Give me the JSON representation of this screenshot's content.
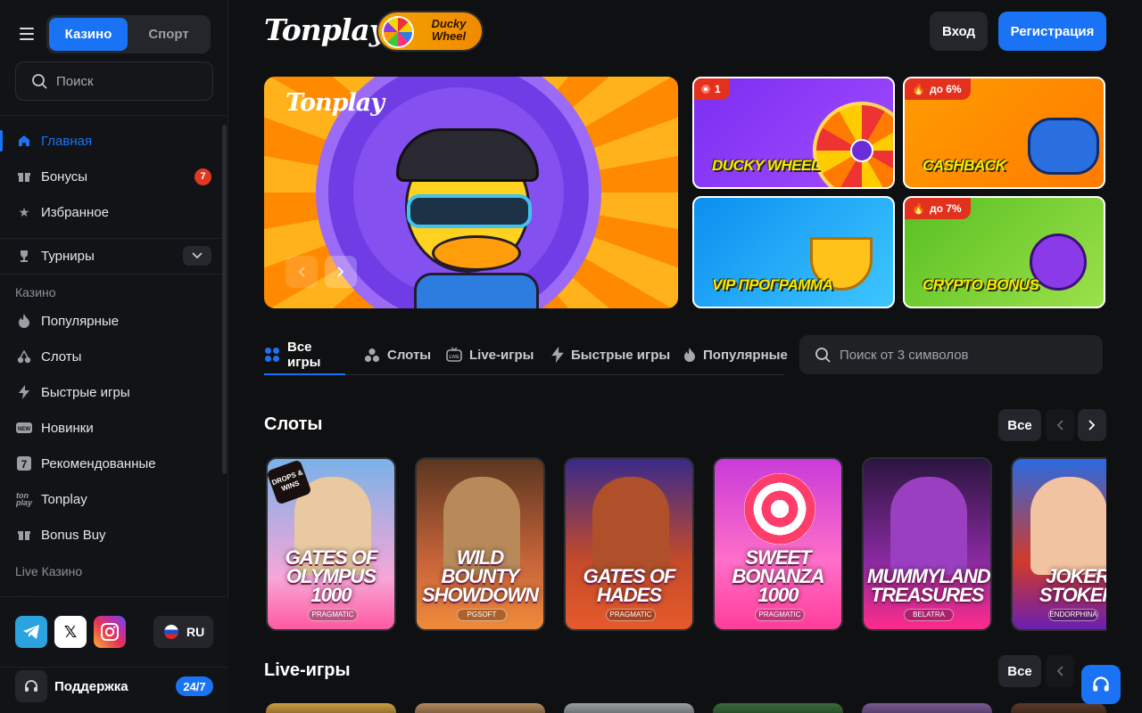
{
  "sidebar": {
    "mode_tabs": [
      "Казино",
      "Спорт"
    ],
    "search_placeholder": "Поиск",
    "main_items": [
      {
        "label": "Главная",
        "icon": "home-icon",
        "active": true
      },
      {
        "label": "Бонусы",
        "icon": "gift-icon",
        "badge": "7"
      },
      {
        "label": "Избранное",
        "icon": "star-icon"
      }
    ],
    "tournaments_label": "Турниры",
    "casino_section": "Казино",
    "casino_items": [
      {
        "label": "Популярные",
        "icon": "fire-icon"
      },
      {
        "label": "Слоты",
        "icon": "cherries-icon"
      },
      {
        "label": "Быстрые игры",
        "icon": "lightning-icon"
      },
      {
        "label": "Новинки",
        "icon": "new-icon"
      },
      {
        "label": "Рекомендованные",
        "icon": "seven-icon"
      },
      {
        "label": "Tonplay",
        "icon": "tonplay-icon"
      },
      {
        "label": "Bonus Buy",
        "icon": "gift-icon"
      }
    ],
    "live_section": "Live Казино",
    "language": "RU",
    "support_label": "Поддержка",
    "support_badge": "24/7",
    "x_glyph": "𝕏"
  },
  "header": {
    "logo": "Tonplay",
    "promo_pill": "Ducky Wheel",
    "login": "Вход",
    "register": "Регистрация"
  },
  "hero": {
    "logo": "Tonplay"
  },
  "promos": [
    {
      "title": "DUCKY WHEEL",
      "badge": "1"
    },
    {
      "title": "CASHBACK",
      "badge": "до 6%"
    },
    {
      "title": "VIP ПРОГРАММА"
    },
    {
      "title": "CRYPTO BONUS",
      "badge": "до 7%"
    }
  ],
  "category_tabs": [
    {
      "label": "Все игры",
      "icon": "grid-icon",
      "active": true
    },
    {
      "label": "Слоты",
      "icon": "cherries-icon"
    },
    {
      "label": "Live-игры",
      "icon": "tv-icon"
    },
    {
      "label": "Быстрые игры",
      "icon": "lightning-icon"
    },
    {
      "label": "Популярные",
      "icon": "fire-icon"
    }
  ],
  "game_search_placeholder": "Поиск от 3 символов",
  "slots_section": {
    "title": "Слоты",
    "all_label": "Все",
    "games": [
      {
        "name": "GATES OF OLYMPUS 1000",
        "provider": "PRAGMATIC",
        "tag": "DROPS & WINS"
      },
      {
        "name": "WILD BOUNTY SHOWDOWN",
        "provider": "PGSOFT"
      },
      {
        "name": "GATES OF HADES",
        "provider": "PRAGMATIC"
      },
      {
        "name": "SWEET BONANZA 1000",
        "provider": "PRAGMATIC"
      },
      {
        "name": "MUMMYLAND TREASURES",
        "provider": "BELATRA"
      },
      {
        "name": "JOKER STOKER",
        "provider": "ENDORPHINA"
      }
    ]
  },
  "live_section": {
    "title": "Live-игры",
    "all_label": "Все"
  }
}
